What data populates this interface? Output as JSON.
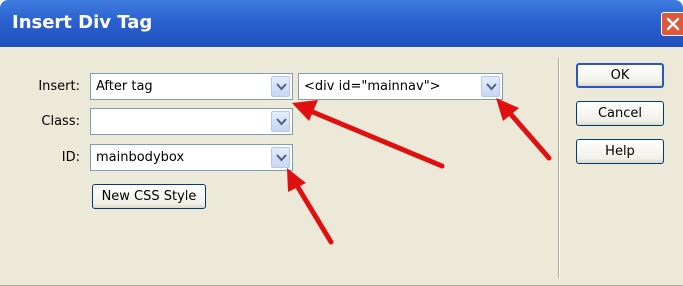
{
  "window": {
    "title": "Insert Div Tag"
  },
  "form": {
    "insert": {
      "label": "Insert:",
      "position_value": "After tag",
      "tag_value": "<div id=\"mainnav\">"
    },
    "class": {
      "label": "Class:",
      "value": ""
    },
    "id": {
      "label": "ID:",
      "value": "mainbodybox"
    },
    "new_css_style_label": "New CSS Style"
  },
  "buttons": {
    "ok": "OK",
    "cancel": "Cancel",
    "help": "Help"
  },
  "icons": {
    "close": "close-icon",
    "dropdown": "chevron-down-icon",
    "annotation": "red-arrow-annotation"
  },
  "colors": {
    "titlebar": "#2b61cf",
    "dialog_bg": "#ece9d8",
    "arrow": "#e01010"
  }
}
